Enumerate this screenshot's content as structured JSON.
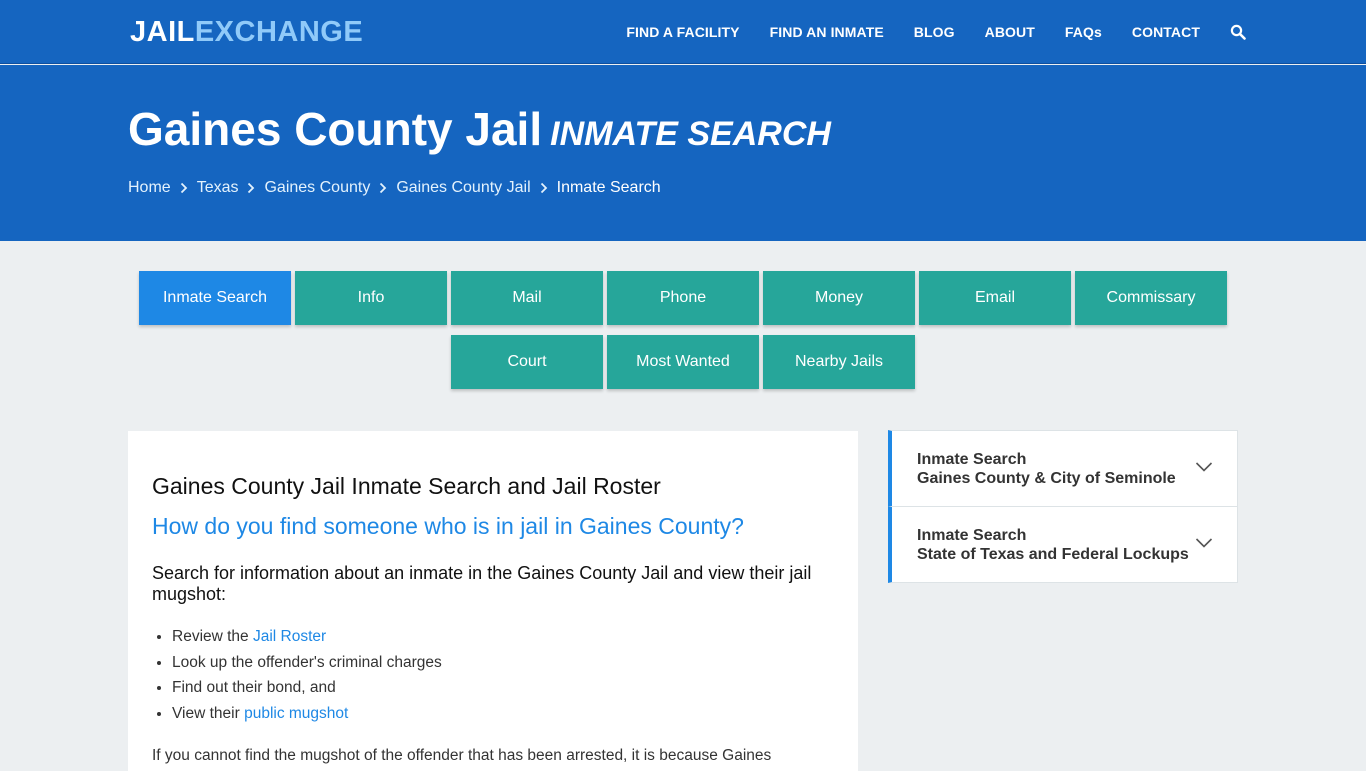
{
  "logo": {
    "part1": "JAIL",
    "part2": "EXCHANGE"
  },
  "nav": {
    "items": [
      "FIND A FACILITY",
      "FIND AN INMATE",
      "BLOG",
      "ABOUT",
      "FAQs",
      "CONTACT"
    ]
  },
  "hero": {
    "title": "Gaines County Jail",
    "subtitle": "INMATE SEARCH",
    "breadcrumbs": [
      "Home",
      "Texas",
      "Gaines County",
      "Gaines County Jail"
    ],
    "current": "Inmate Search"
  },
  "tabs": {
    "row1": [
      "Inmate Search",
      "Info",
      "Mail",
      "Phone",
      "Money",
      "Email",
      "Commissary"
    ],
    "row2": [
      "Court",
      "Most Wanted",
      "Nearby Jails"
    ],
    "active": "Inmate Search"
  },
  "content": {
    "heading": "Gaines County Jail Inmate Search and Jail Roster",
    "question": "How do you find someone who is in jail in Gaines County?",
    "lead": "Search for information about an inmate in the Gaines County Jail and view their jail mugshot:",
    "list": {
      "item1_prefix": "Review the ",
      "item1_link": "Jail Roster",
      "item2": "Look up the offender's criminal charges",
      "item3": "Find out their bond, and",
      "item4_prefix": "View their ",
      "item4_link": "public mugshot"
    },
    "para": "If you cannot find the mugshot of the offender that has been arrested, it is because Gaines"
  },
  "sidebar": {
    "items": [
      {
        "line1": "Inmate Search",
        "line2": "Gaines County & City of Seminole"
      },
      {
        "line1": "Inmate Search",
        "line2": "State of Texas and Federal Lockups"
      }
    ]
  },
  "colors": {
    "primary": "#1565c0",
    "accent": "#1e88e5",
    "teal": "#26a69a",
    "background": "#eceff1"
  },
  "icons": {
    "search": "search-icon",
    "breadcrumb_sep": "chevron-right-icon",
    "accordion": "chevron-down-icon"
  }
}
